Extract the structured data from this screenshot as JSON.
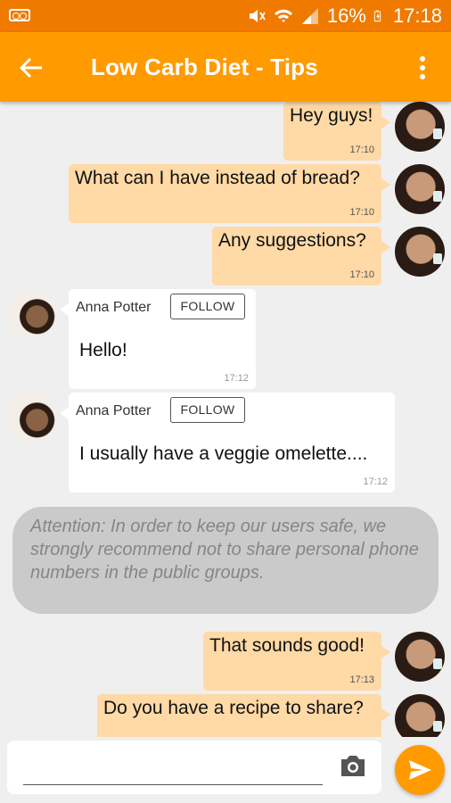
{
  "status_bar": {
    "battery": "16%",
    "time": "17:18"
  },
  "header": {
    "title": "Low Carb Diet - Tips"
  },
  "messages": [
    {
      "text": "Hey guys!",
      "time": "17:10"
    },
    {
      "text": "What can I have instead of bread?",
      "time": "17:10"
    },
    {
      "text": "Any suggestions?",
      "time": "17:10"
    },
    {
      "sender": "Anna Potter",
      "follow": "FOLLOW",
      "text": "Hello!",
      "time": "17:12"
    },
    {
      "sender": "Anna Potter",
      "follow": "FOLLOW",
      "text": "I usually have a veggie omelette....",
      "time": "17:12"
    },
    {
      "text": "That sounds good!",
      "time": "17:13"
    },
    {
      "text": "Do you have a recipe to share?"
    }
  ],
  "notice": "Attention: In order to keep our users safe, we strongly recommend not to share personal phone numbers in the public groups.",
  "composer": {
    "placeholder": ""
  },
  "colors": {
    "status_bar": "#f07a00",
    "app_bar": "#ff9a00",
    "outgoing": "#ffd9a6",
    "incoming": "#ffffff",
    "notice": "#cacaca"
  }
}
